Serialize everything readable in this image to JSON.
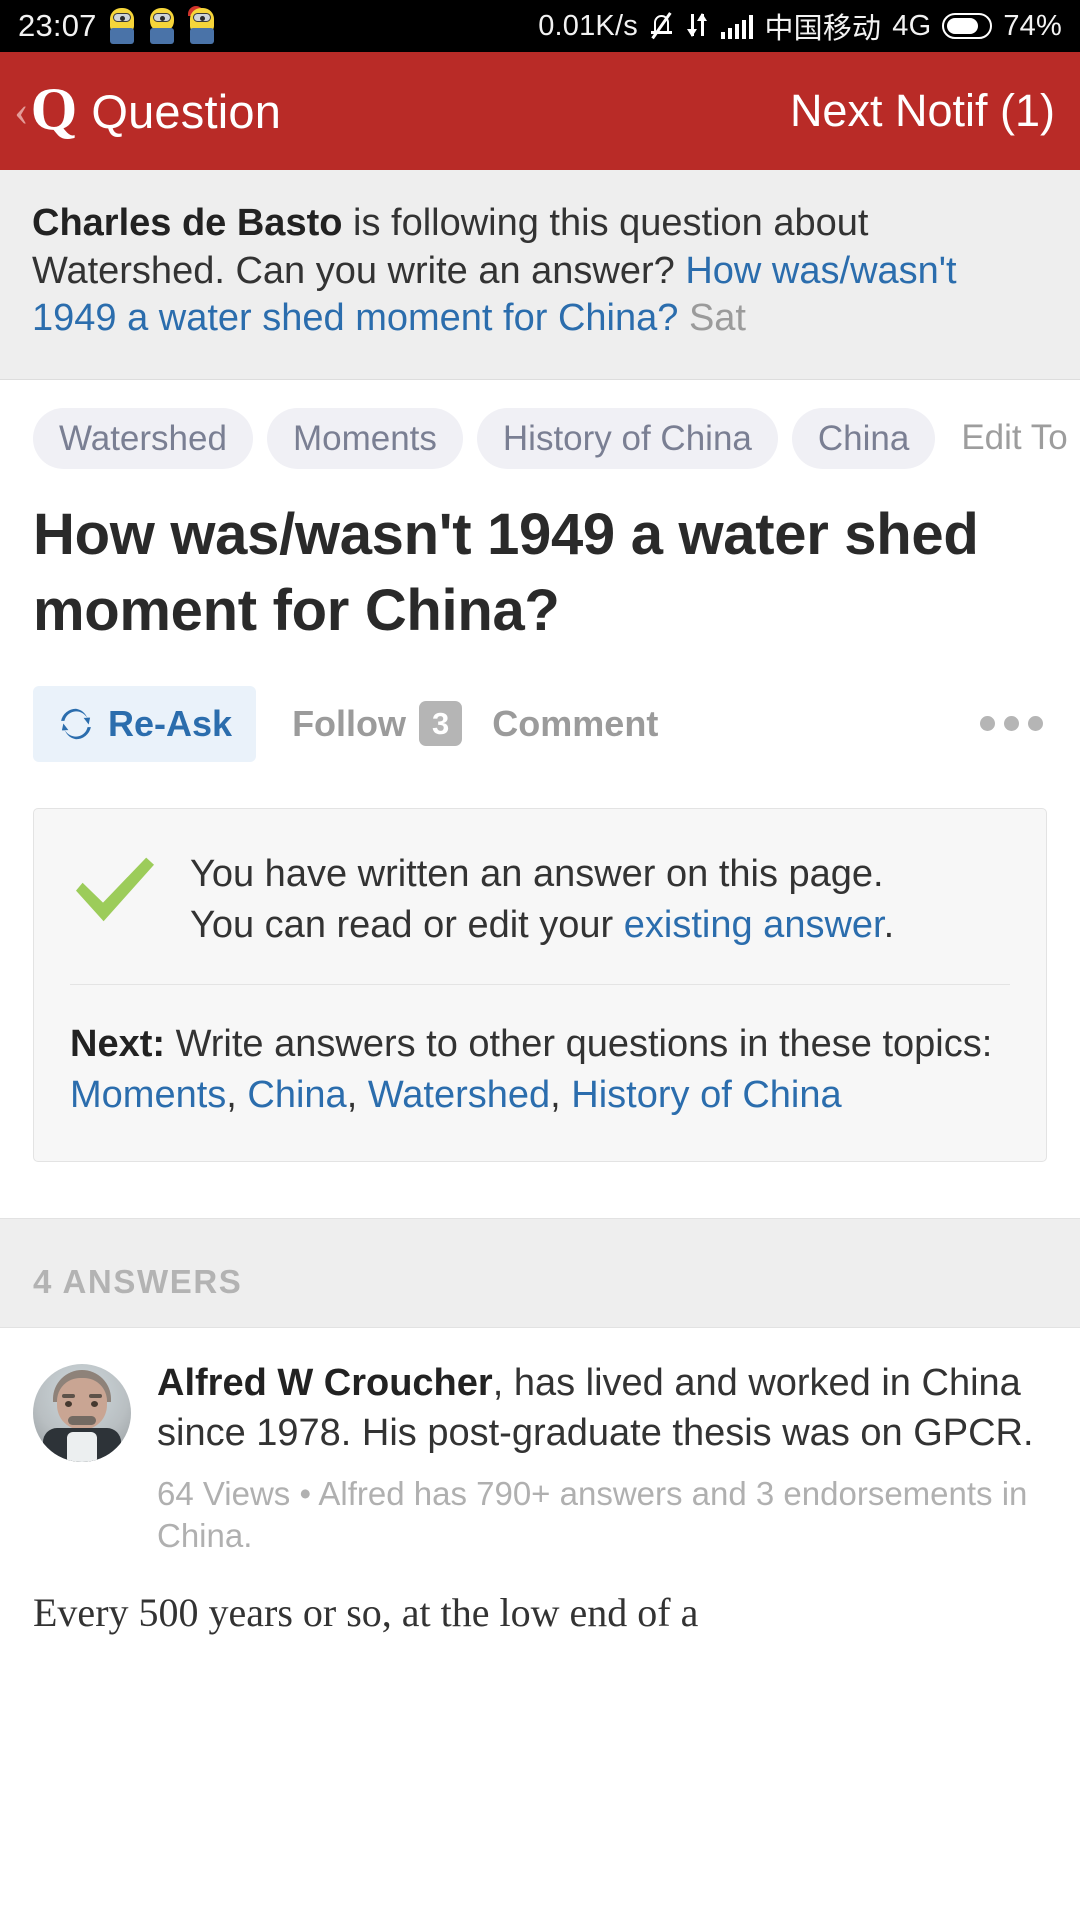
{
  "status_bar": {
    "time": "23:07",
    "network_speed": "0.01K/s",
    "carrier": "中国移动",
    "network_type": "4G",
    "battery_percent": "74%",
    "icons": [
      "minion-icon",
      "minion-icon",
      "minion-icon",
      "bell-mute-icon",
      "data-transfer-icon",
      "signal-bars-icon",
      "battery-icon"
    ]
  },
  "header": {
    "back_chevron": "‹",
    "logo": "Q",
    "title": "Question",
    "action": "Next Notif (1)",
    "brand_color": "#b92b27"
  },
  "notification": {
    "actor": "Charles de Basto",
    "text_before": " is following this question about Watershed. Can you write an answer? ",
    "question_link": "How was/wasn't 1949 a water shed moment for China?",
    "timestamp": "Sat"
  },
  "topics": {
    "pills": [
      "Watershed",
      "Moments",
      "History of China",
      "China"
    ],
    "edit_label": "Edit To"
  },
  "question": {
    "title": "How was/wasn't 1949 a water shed moment for China?"
  },
  "actions": {
    "reask_label": "Re-Ask",
    "reask_icon": "refresh-icon",
    "follow_label": "Follow",
    "follow_count": "3",
    "comment_label": "Comment",
    "more_icon": "more-dots-icon",
    "accent_color": "#2b6dad"
  },
  "info_card": {
    "check_icon": "green-check-icon",
    "line1": "You have written an answer on this page.",
    "line2_before": "You can read or edit your ",
    "line2_link": "existing answer",
    "line2_after": ".",
    "next_label": "Next:",
    "next_text": " Write answers to other questions in these topics: ",
    "next_topics": [
      "Moments",
      "China",
      "Watershed",
      "History of China"
    ],
    "check_color": "#9ccc5a"
  },
  "answers_section": {
    "heading": "4 ANSWERS",
    "answers": [
      {
        "avatar": "user-avatar",
        "author": "Alfred W Croucher",
        "credential": ", has lived and worked in China since 1978. His post-graduate thesis was on GPCR.",
        "meta": "64 Views • Alfred has 790+ answers and 3 endorsements in China.",
        "body_excerpt": "Every 500 years or so, at the low end of a"
      }
    ]
  }
}
